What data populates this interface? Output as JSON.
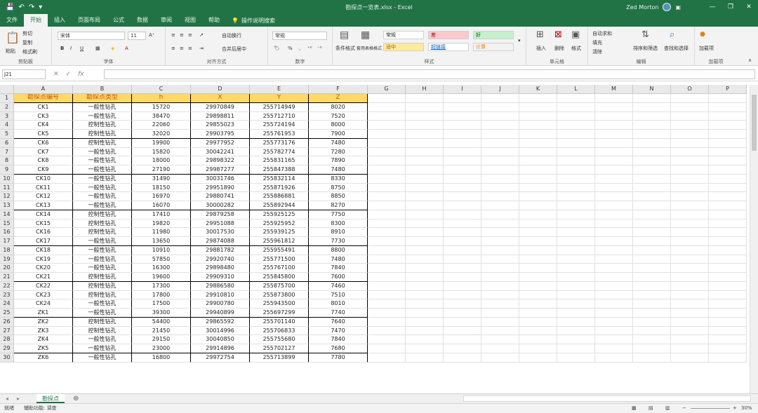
{
  "titlebar": {
    "document_title": "勘探点一览表.xlsx - Excel",
    "user_name": "Zed Morton",
    "minimize": "—",
    "restore": "❐",
    "close": "✕"
  },
  "tabs": [
    "文件",
    "开始",
    "插入",
    "页面布局",
    "公式",
    "数据",
    "审阅",
    "视图",
    "帮助"
  ],
  "active_tab": "开始",
  "tell_me": "操作说明搜索",
  "ribbon": {
    "clipboard": {
      "label": "剪贴板",
      "paste": "粘贴",
      "cut": "剪切",
      "copy": "复制",
      "format_painter": "格式刷"
    },
    "font": {
      "label": "字体",
      "font_name": "宋体",
      "font_size": "11",
      "bold": "B",
      "italic": "I",
      "underline": "U"
    },
    "alignment": {
      "label": "对齐方式",
      "wrap_text": "自动换行",
      "merge_center": "合并后居中"
    },
    "number": {
      "label": "数字",
      "format": "常规",
      "percent": "%"
    },
    "styles": {
      "label": "样式",
      "conditional": "条件格式",
      "table": "套用表格格式",
      "normal": "常规",
      "bad": "差",
      "good": "好",
      "neutral": "适中",
      "hyperlink": "超链接",
      "calc": "计算"
    },
    "cells": {
      "label": "单元格",
      "insert": "插入",
      "delete": "删除",
      "format": "格式"
    },
    "editing": {
      "label": "编辑",
      "autosum": "自动求和",
      "fill": "填充",
      "clear": "清除",
      "sort": "排序和筛选",
      "find": "查找和选择"
    },
    "addins": {
      "label": "加载项",
      "addin": "加载项"
    }
  },
  "formula_bar": {
    "name_box": "J21",
    "cancel": "✕",
    "enter": "✓",
    "fx": "fx",
    "value": ""
  },
  "grid": {
    "columns": [
      "A",
      "B",
      "C",
      "D",
      "E",
      "F",
      "G",
      "H",
      "I",
      "J",
      "K",
      "L",
      "M",
      "N",
      "O",
      "P"
    ],
    "header": [
      "勘探点编号",
      "勘探点类型",
      "h",
      "X",
      "Y",
      "Z"
    ],
    "rows": [
      [
        "CK1",
        "一般性钻孔",
        "15720",
        "29970849",
        "255714949",
        "8020"
      ],
      [
        "CK3",
        "一般性钻孔",
        "38470",
        "29898811",
        "255712710",
        "7520"
      ],
      [
        "CK4",
        "控制性钻孔",
        "22060",
        "29855023",
        "255724194",
        "8000"
      ],
      [
        "CK5",
        "控制性钻孔",
        "32020",
        "29903795",
        "255761953",
        "7900"
      ],
      [
        "CK6",
        "控制性钻孔",
        "19900",
        "29977952",
        "255773176",
        "7480"
      ],
      [
        "CK7",
        "一般性钻孔",
        "15820",
        "30042241",
        "255782774",
        "7280"
      ],
      [
        "CK8",
        "一般性钻孔",
        "18000",
        "29898322",
        "255831165",
        "7890"
      ],
      [
        "CK9",
        "一般性钻孔",
        "27190",
        "29987277",
        "255847388",
        "7480"
      ],
      [
        "CK10",
        "一般性钻孔",
        "31490",
        "30031746",
        "255832114",
        "8330"
      ],
      [
        "CK11",
        "一般性钻孔",
        "18150",
        "29951890",
        "255871926",
        "8750"
      ],
      [
        "CK12",
        "一般性钻孔",
        "16970",
        "29880741",
        "255886881",
        "8850"
      ],
      [
        "CK13",
        "一般性钻孔",
        "16070",
        "30000282",
        "255892944",
        "8270"
      ],
      [
        "CK14",
        "控制性钻孔",
        "17410",
        "29879258",
        "255925125",
        "7750"
      ],
      [
        "CK15",
        "控制性钻孔",
        "19820",
        "29951088",
        "255925952",
        "8300"
      ],
      [
        "CK16",
        "控制性钻孔",
        "11980",
        "30017530",
        "255939125",
        "8910"
      ],
      [
        "CK17",
        "一般性钻孔",
        "13650",
        "29874088",
        "255961812",
        "7730"
      ],
      [
        "CK18",
        "一般性钻孔",
        "10910",
        "29881782",
        "255955491",
        "8800"
      ],
      [
        "CK19",
        "一般性钻孔",
        "57850",
        "29920740",
        "255771500",
        "7480"
      ],
      [
        "CK20",
        "一般性钻孔",
        "16300",
        "29898480",
        "255767100",
        "7840"
      ],
      [
        "CK21",
        "控制性钻孔",
        "19600",
        "29909310",
        "255845800",
        "7600"
      ],
      [
        "CK22",
        "控制性钻孔",
        "17300",
        "29886580",
        "255875700",
        "7460"
      ],
      [
        "CK23",
        "控制性钻孔",
        "17800",
        "29910810",
        "255873800",
        "7510"
      ],
      [
        "CK24",
        "一般性钻孔",
        "17500",
        "29900780",
        "255943500",
        "8010"
      ],
      [
        "ZK1",
        "一般性钻孔",
        "39300",
        "29940899",
        "255697299",
        "7740"
      ],
      [
        "ZK2",
        "控制性钻孔",
        "54400",
        "29865592",
        "255701140",
        "7640"
      ],
      [
        "ZK3",
        "控制性钻孔",
        "21450",
        "30014996",
        "255706833",
        "7470"
      ],
      [
        "ZK4",
        "一般性钻孔",
        "29150",
        "30040850",
        "255755680",
        "7840"
      ],
      [
        "ZK5",
        "一般性钻孔",
        "23000",
        "29914896",
        "255702127",
        "7680"
      ],
      [
        "ZK6",
        "一般性钻孔",
        "16800",
        "29972754",
        "255713899",
        "7780"
      ]
    ]
  },
  "sheets": {
    "active": "勘探点",
    "add": "⊕"
  },
  "status": {
    "ready": "就绪",
    "accessibility": "辅助功能: 调查",
    "zoom": "30%"
  }
}
